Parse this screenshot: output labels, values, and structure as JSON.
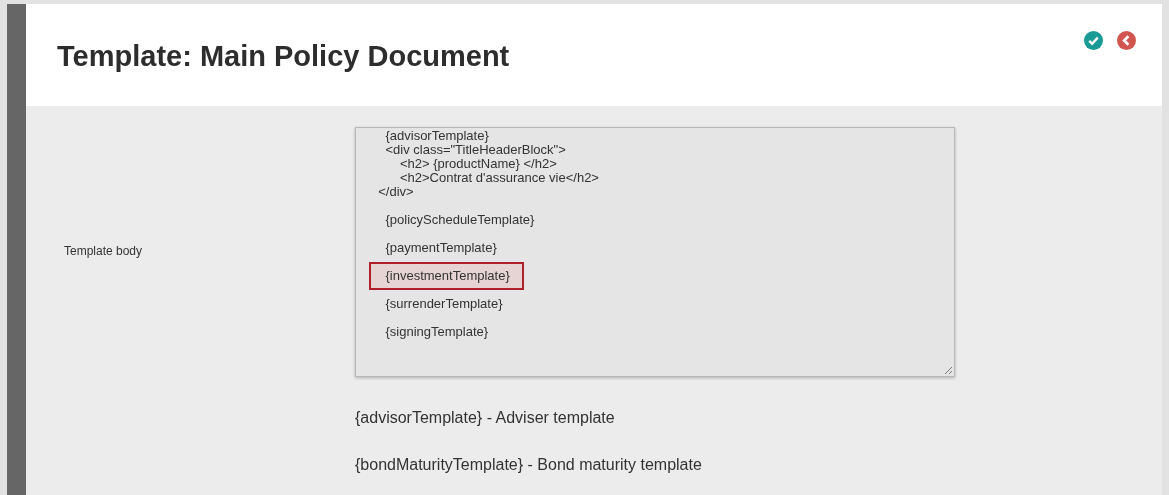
{
  "header": {
    "title": "Template: Main Policy Document",
    "actions": [
      {
        "kind": "confirm"
      },
      {
        "kind": "back"
      }
    ]
  },
  "form": {
    "label": "Template body",
    "blocks": [
      {
        "lines": [
          "    {advisorTemplate}",
          "    <div class=\"TitleHeaderBlock\">",
          "        <h2> {productName} </h2>",
          "        <h2>Contrat d'assurance vie</h2>",
          "  </div>"
        ],
        "highlighted": false
      },
      {
        "lines": [
          "    {policyScheduleTemplate}"
        ],
        "highlighted": false
      },
      {
        "lines": [
          "    {paymentTemplate}"
        ],
        "highlighted": false
      },
      {
        "lines": [
          "    {investmentTemplate}"
        ],
        "highlighted": true
      },
      {
        "lines": [
          "    {surrenderTemplate}"
        ],
        "highlighted": false
      },
      {
        "lines": [
          "    {signingTemplate}"
        ],
        "highlighted": false
      }
    ],
    "legend": [
      "{advisorTemplate} - Adviser template",
      "{bondMaturityTemplate} - Bond maturity template"
    ]
  }
}
